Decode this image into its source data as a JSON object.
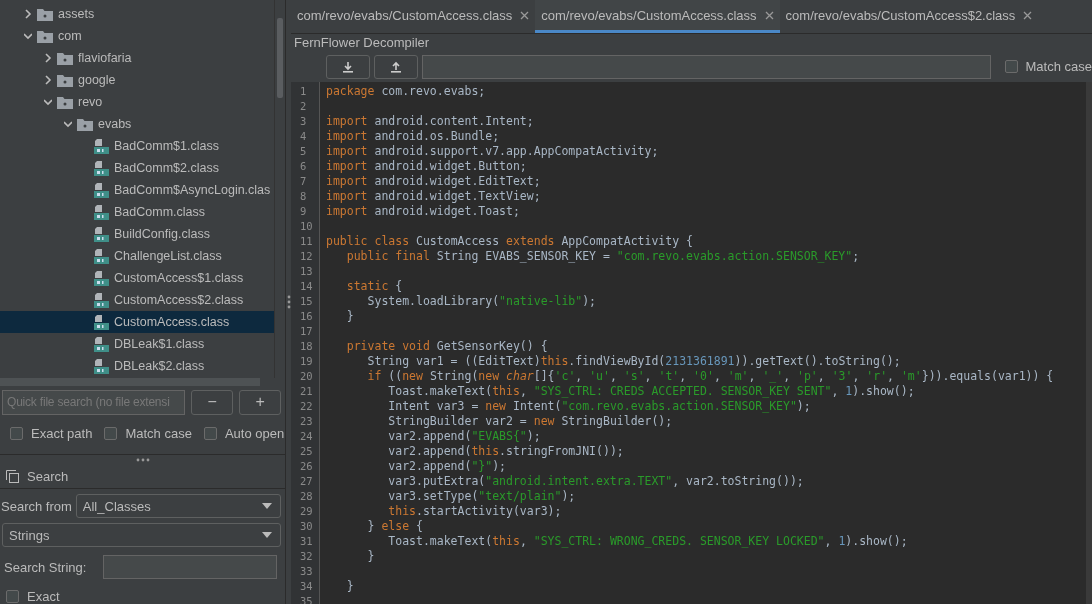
{
  "file_tree": {
    "items": [
      {
        "kind": "folder",
        "label": "assets",
        "expanded": false,
        "selected": false
      },
      {
        "kind": "folder",
        "label": "com",
        "expanded": true,
        "selected": false,
        "children": [
          {
            "kind": "folder",
            "label": "flaviofaria",
            "expanded": false,
            "selected": false
          },
          {
            "kind": "folder",
            "label": "google",
            "expanded": false,
            "selected": false
          },
          {
            "kind": "folder",
            "label": "revo",
            "expanded": true,
            "selected": false,
            "children": [
              {
                "kind": "folder",
                "label": "evabs",
                "expanded": true,
                "selected": false,
                "children": [
                  {
                    "kind": "class",
                    "label": "BadComm$1.class",
                    "selected": false
                  },
                  {
                    "kind": "class",
                    "label": "BadComm$2.class",
                    "selected": false
                  },
                  {
                    "kind": "class",
                    "label": "BadComm$AsyncLogin.clas",
                    "selected": false
                  },
                  {
                    "kind": "class",
                    "label": "BadComm.class",
                    "selected": false
                  },
                  {
                    "kind": "class",
                    "label": "BuildConfig.class",
                    "selected": false
                  },
                  {
                    "kind": "class",
                    "label": "ChallengeList.class",
                    "selected": false
                  },
                  {
                    "kind": "class",
                    "label": "CustomAccess$1.class",
                    "selected": false
                  },
                  {
                    "kind": "class",
                    "label": "CustomAccess$2.class",
                    "selected": false
                  },
                  {
                    "kind": "class",
                    "label": "CustomAccess.class",
                    "selected": true
                  },
                  {
                    "kind": "class",
                    "label": "DBLeak$1.class",
                    "selected": false
                  },
                  {
                    "kind": "class",
                    "label": "DBLeak$2.class",
                    "selected": false
                  }
                ]
              }
            ]
          }
        ]
      }
    ]
  },
  "quick_search": {
    "placeholder": "Quick file search (no file extensi",
    "buttons": [
      "−",
      "+"
    ]
  },
  "tree_options": [
    {
      "label": "Exact path",
      "checked": false
    },
    {
      "label": "Match case",
      "checked": false
    },
    {
      "label": "Auto open",
      "checked": false
    }
  ],
  "search_panel": {
    "title": "Search",
    "search_from_label": "Search from",
    "search_from_value": "All_Classes",
    "type_value": "Strings",
    "search_string_label": "Search String:",
    "exact": {
      "label": "Exact",
      "checked": false
    }
  },
  "tabs": [
    {
      "label": "com/revo/evabs/CustomAccess.class",
      "selected": false
    },
    {
      "label": "com/revo/evabs/CustomAccess.class",
      "selected": true
    },
    {
      "label": "com/revo/evabs/CustomAccess$2.class",
      "selected": false
    }
  ],
  "decompiler": {
    "title": "FernFlower Decompiler",
    "match_case": {
      "label": "Match case",
      "checked": false
    }
  },
  "code": {
    "lines": [
      {
        "number": "1",
        "tokens": [
          {
            "kind": "k",
            "text": "package"
          },
          {
            "kind": "p",
            "text": " com.revo.evabs;"
          }
        ]
      },
      {
        "number": "2"
      },
      {
        "number": "3",
        "tokens": [
          {
            "kind": "k",
            "text": "import"
          },
          {
            "kind": "p",
            "text": " android.content.Intent;"
          }
        ]
      },
      {
        "number": "4",
        "tokens": [
          {
            "kind": "k",
            "text": "import"
          },
          {
            "kind": "p",
            "text": " android.os.Bundle;"
          }
        ]
      },
      {
        "number": "5",
        "tokens": [
          {
            "kind": "k",
            "text": "import"
          },
          {
            "kind": "p",
            "text": " android.support.v7.app.AppCompatActivity;"
          }
        ]
      },
      {
        "number": "6",
        "tokens": [
          {
            "kind": "k",
            "text": "import"
          },
          {
            "kind": "p",
            "text": " android.widget.Button;"
          }
        ]
      },
      {
        "number": "7",
        "tokens": [
          {
            "kind": "k",
            "text": "import"
          },
          {
            "kind": "p",
            "text": " android.widget.EditText;"
          }
        ]
      },
      {
        "number": "8",
        "tokens": [
          {
            "kind": "k",
            "text": "import"
          },
          {
            "kind": "p",
            "text": " android.widget.TextView;"
          }
        ]
      },
      {
        "number": "9",
        "tokens": [
          {
            "kind": "k",
            "text": "import"
          },
          {
            "kind": "p",
            "text": " android.widget.Toast;"
          }
        ]
      },
      {
        "number": "10"
      },
      {
        "number": "11",
        "tokens": [
          {
            "kind": "k",
            "text": "public class"
          },
          {
            "kind": "p",
            "text": " CustomAccess "
          },
          {
            "kind": "k",
            "text": "extends"
          },
          {
            "kind": "p",
            "text": " AppCompatActivity {"
          }
        ]
      },
      {
        "number": "12",
        "tokens": [
          {
            "kind": "k",
            "text": "   public final"
          },
          {
            "kind": "p",
            "text": " String EVABS_SENSOR_KEY = "
          },
          {
            "kind": "s",
            "text": "\"com.revo.evabs.action.SENSOR_KEY\""
          },
          {
            "kind": "p",
            "text": ";"
          }
        ]
      },
      {
        "number": "13"
      },
      {
        "number": "14",
        "tokens": [
          {
            "kind": "k",
            "text": "   static"
          },
          {
            "kind": "p",
            "text": " {"
          }
        ]
      },
      {
        "number": "15",
        "tokens": [
          {
            "kind": "p",
            "text": "      System.loadLibrary("
          },
          {
            "kind": "s",
            "text": "\"native-lib\""
          },
          {
            "kind": "p",
            "text": ");"
          }
        ]
      },
      {
        "number": "16",
        "tokens": [
          {
            "kind": "p",
            "text": "   }"
          }
        ]
      },
      {
        "number": "17"
      },
      {
        "number": "18",
        "tokens": [
          {
            "kind": "k",
            "text": "   private void"
          },
          {
            "kind": "p",
            "text": " GetSensorKey() {"
          }
        ]
      },
      {
        "number": "19",
        "tokens": [
          {
            "kind": "p",
            "text": "      String var1 = ((EditText)"
          },
          {
            "kind": "k",
            "text": "this"
          },
          {
            "kind": "p",
            "text": ".findViewById("
          },
          {
            "kind": "n",
            "text": "2131361891"
          },
          {
            "kind": "p",
            "text": ")).getText().toString();"
          }
        ]
      },
      {
        "number": "20",
        "tokens": [
          {
            "kind": "k",
            "text": "      if"
          },
          {
            "kind": "p",
            "text": " (("
          },
          {
            "kind": "k",
            "text": "new"
          },
          {
            "kind": "p",
            "text": " String("
          },
          {
            "kind": "k",
            "text": "new "
          },
          {
            "kind": "ki",
            "text": "char"
          },
          {
            "kind": "p",
            "text": "[]{"
          },
          {
            "kind": "s",
            "text": "'c'"
          },
          {
            "kind": "p",
            "text": ", "
          },
          {
            "kind": "s",
            "text": "'u'"
          },
          {
            "kind": "p",
            "text": ", "
          },
          {
            "kind": "s",
            "text": "'s'"
          },
          {
            "kind": "p",
            "text": ", "
          },
          {
            "kind": "s",
            "text": "'t'"
          },
          {
            "kind": "p",
            "text": ", "
          },
          {
            "kind": "s",
            "text": "'0'"
          },
          {
            "kind": "p",
            "text": ", "
          },
          {
            "kind": "s",
            "text": "'m'"
          },
          {
            "kind": "p",
            "text": ", "
          },
          {
            "kind": "s",
            "text": "'_'"
          },
          {
            "kind": "p",
            "text": ", "
          },
          {
            "kind": "s",
            "text": "'p'"
          },
          {
            "kind": "p",
            "text": ", "
          },
          {
            "kind": "s",
            "text": "'3'"
          },
          {
            "kind": "p",
            "text": ", "
          },
          {
            "kind": "s",
            "text": "'r'"
          },
          {
            "kind": "p",
            "text": ", "
          },
          {
            "kind": "s",
            "text": "'m'"
          },
          {
            "kind": "p",
            "text": "})).equals(var1)) {"
          }
        ]
      },
      {
        "number": "21",
        "tokens": [
          {
            "kind": "p",
            "text": "         Toast.makeText("
          },
          {
            "kind": "k",
            "text": "this"
          },
          {
            "kind": "p",
            "text": ", "
          },
          {
            "kind": "s",
            "text": "\"SYS_CTRL: CREDS ACCEPTED. SENSOR_KEY SENT\""
          },
          {
            "kind": "p",
            "text": ", "
          },
          {
            "kind": "n",
            "text": "1"
          },
          {
            "kind": "p",
            "text": ").show();"
          }
        ]
      },
      {
        "number": "22",
        "tokens": [
          {
            "kind": "p",
            "text": "         Intent var3 = "
          },
          {
            "kind": "k",
            "text": "new"
          },
          {
            "kind": "p",
            "text": " Intent("
          },
          {
            "kind": "s",
            "text": "\"com.revo.evabs.action.SENSOR_KEY\""
          },
          {
            "kind": "p",
            "text": ");"
          }
        ]
      },
      {
        "number": "23",
        "tokens": [
          {
            "kind": "p",
            "text": "         StringBuilder var2 = "
          },
          {
            "kind": "k",
            "text": "new"
          },
          {
            "kind": "p",
            "text": " StringBuilder();"
          }
        ]
      },
      {
        "number": "24",
        "tokens": [
          {
            "kind": "p",
            "text": "         var2.append("
          },
          {
            "kind": "s",
            "text": "\"EVABS{\""
          },
          {
            "kind": "p",
            "text": ");"
          }
        ]
      },
      {
        "number": "25",
        "tokens": [
          {
            "kind": "p",
            "text": "         var2.append("
          },
          {
            "kind": "k",
            "text": "this"
          },
          {
            "kind": "p",
            "text": ".stringFromJNI());"
          }
        ]
      },
      {
        "number": "26",
        "tokens": [
          {
            "kind": "p",
            "text": "         var2.append("
          },
          {
            "kind": "s",
            "text": "\"}\""
          },
          {
            "kind": "p",
            "text": ");"
          }
        ]
      },
      {
        "number": "27",
        "tokens": [
          {
            "kind": "p",
            "text": "         var3.putExtra("
          },
          {
            "kind": "s",
            "text": "\"android.intent.extra.TEXT\""
          },
          {
            "kind": "p",
            "text": ", var2.toString());"
          }
        ]
      },
      {
        "number": "28",
        "tokens": [
          {
            "kind": "p",
            "text": "         var3.setType("
          },
          {
            "kind": "s",
            "text": "\"text/plain\""
          },
          {
            "kind": "p",
            "text": ");"
          }
        ]
      },
      {
        "number": "29",
        "tokens": [
          {
            "kind": "k",
            "text": "         this"
          },
          {
            "kind": "p",
            "text": ".startActivity(var3);"
          }
        ]
      },
      {
        "number": "30",
        "tokens": [
          {
            "kind": "p",
            "text": "      } "
          },
          {
            "kind": "k",
            "text": "else"
          },
          {
            "kind": "p",
            "text": " {"
          }
        ]
      },
      {
        "number": "31",
        "tokens": [
          {
            "kind": "p",
            "text": "         Toast.makeText("
          },
          {
            "kind": "k",
            "text": "this"
          },
          {
            "kind": "p",
            "text": ", "
          },
          {
            "kind": "s",
            "text": "\"SYS_CTRL: WRONG_CREDS. SENSOR_KEY LOCKED\""
          },
          {
            "kind": "p",
            "text": ", "
          },
          {
            "kind": "n",
            "text": "1"
          },
          {
            "kind": "p",
            "text": ").show();"
          }
        ]
      },
      {
        "number": "32",
        "tokens": [
          {
            "kind": "p",
            "text": "      }"
          }
        ]
      },
      {
        "number": "33"
      },
      {
        "number": "34",
        "tokens": [
          {
            "kind": "p",
            "text": "   }"
          }
        ]
      },
      {
        "number": "35"
      }
    ]
  }
}
